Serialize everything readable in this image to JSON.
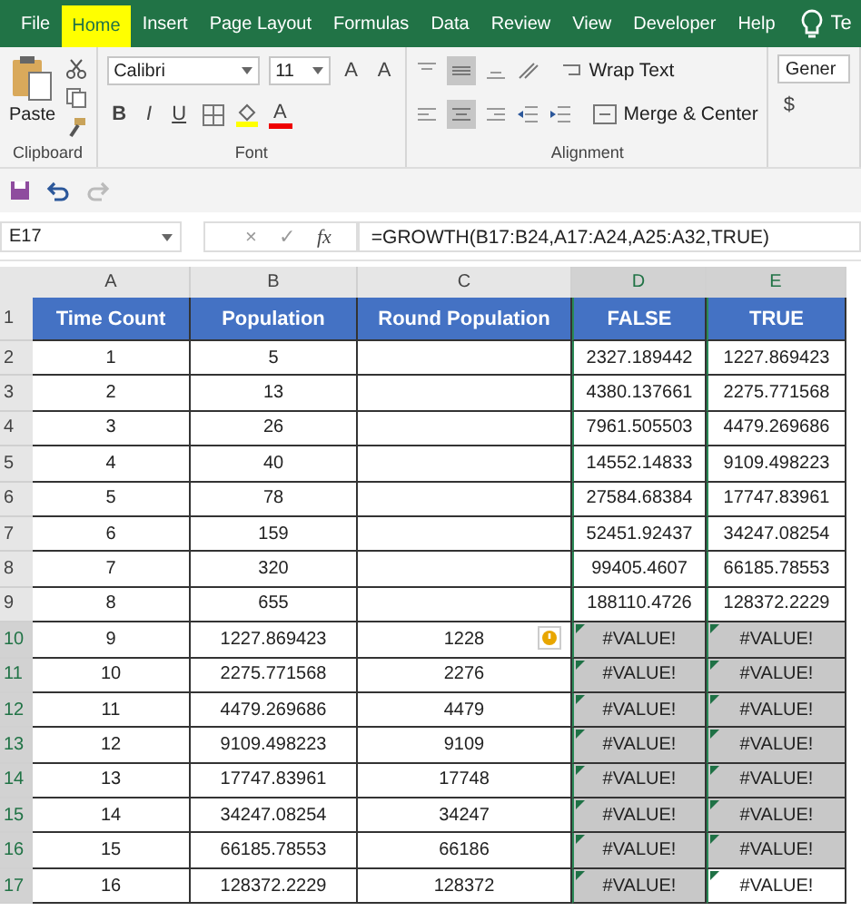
{
  "ribbon": {
    "tabs": [
      {
        "label": "File",
        "selected": false
      },
      {
        "label": "Home",
        "selected": true
      },
      {
        "label": "Insert",
        "selected": false
      },
      {
        "label": "Page Layout",
        "selected": false
      },
      {
        "label": "Formulas",
        "selected": false
      },
      {
        "label": "Data",
        "selected": false
      },
      {
        "label": "Review",
        "selected": false
      },
      {
        "label": "View",
        "selected": false
      },
      {
        "label": "Developer",
        "selected": false
      },
      {
        "label": "Help",
        "selected": false
      }
    ],
    "tell_me": "Te",
    "clipboard": {
      "paste": "Paste",
      "label": "Clipboard"
    },
    "font": {
      "name": "Calibri",
      "size": "11",
      "grow": "A",
      "shrink": "A",
      "bold": "B",
      "italic": "I",
      "underline": "U",
      "color_glyph": "A",
      "label": "Font"
    },
    "alignment": {
      "wrap_text": "Wrap Text",
      "merge_center": "Merge & Center",
      "label": "Alignment"
    },
    "number": {
      "format": "Gener",
      "currency": "$"
    }
  },
  "formula_bar": {
    "name_box": "E17",
    "cancel": "×",
    "enter": "✓",
    "fx": "fx",
    "formula": "=GROWTH(B17:B24,A17:A24,A25:A32,TRUE)"
  },
  "sheet": {
    "columns": [
      {
        "label": "A",
        "selected": false
      },
      {
        "label": "B",
        "selected": false
      },
      {
        "label": "C",
        "selected": false
      },
      {
        "label": "D",
        "selected": true
      },
      {
        "label": "E",
        "selected": true
      }
    ],
    "rows": [
      {
        "number": "1",
        "kind": "header",
        "selected": false,
        "error_marks": false,
        "warning": false,
        "cells": [
          "Time Count",
          "Population",
          "Round Population",
          "FALSE",
          "TRUE"
        ],
        "selected_cells": [
          false,
          false,
          false,
          false,
          false
        ]
      },
      {
        "number": "2",
        "kind": "data",
        "selected": false,
        "error_marks": false,
        "warning": false,
        "cells": [
          "1",
          "5",
          "",
          "2327.189442",
          "1227.869423"
        ],
        "selected_cells": [
          false,
          false,
          false,
          false,
          false
        ]
      },
      {
        "number": "3",
        "kind": "data",
        "selected": false,
        "error_marks": false,
        "warning": false,
        "cells": [
          "2",
          "13",
          "",
          "4380.137661",
          "2275.771568"
        ],
        "selected_cells": [
          false,
          false,
          false,
          false,
          false
        ]
      },
      {
        "number": "4",
        "kind": "data",
        "selected": false,
        "error_marks": false,
        "warning": false,
        "cells": [
          "3",
          "26",
          "",
          "7961.505503",
          "4479.269686"
        ],
        "selected_cells": [
          false,
          false,
          false,
          false,
          false
        ]
      },
      {
        "number": "5",
        "kind": "data",
        "selected": false,
        "error_marks": false,
        "warning": false,
        "cells": [
          "4",
          "40",
          "",
          "14552.14833",
          "9109.498223"
        ],
        "selected_cells": [
          false,
          false,
          false,
          false,
          false
        ]
      },
      {
        "number": "6",
        "kind": "data",
        "selected": false,
        "error_marks": false,
        "warning": false,
        "cells": [
          "5",
          "78",
          "",
          "27584.68384",
          "17747.83961"
        ],
        "selected_cells": [
          false,
          false,
          false,
          false,
          false
        ]
      },
      {
        "number": "7",
        "kind": "data",
        "selected": false,
        "error_marks": false,
        "warning": false,
        "cells": [
          "6",
          "159",
          "",
          "52451.92437",
          "34247.08254"
        ],
        "selected_cells": [
          false,
          false,
          false,
          false,
          false
        ]
      },
      {
        "number": "8",
        "kind": "data",
        "selected": false,
        "error_marks": false,
        "warning": false,
        "cells": [
          "7",
          "320",
          "",
          "99405.4607",
          "66185.78553"
        ],
        "selected_cells": [
          false,
          false,
          false,
          false,
          false
        ]
      },
      {
        "number": "9",
        "kind": "data",
        "selected": false,
        "error_marks": false,
        "warning": false,
        "cells": [
          "8",
          "655",
          "",
          "188110.4726",
          "128372.2229"
        ],
        "selected_cells": [
          false,
          false,
          false,
          false,
          false
        ]
      },
      {
        "number": "10",
        "kind": "data",
        "selected": true,
        "error_marks": true,
        "warning": true,
        "cells": [
          "9",
          "1227.869423",
          "1228",
          "#VALUE!",
          "#VALUE!"
        ],
        "selected_cells": [
          false,
          false,
          false,
          true,
          true
        ]
      },
      {
        "number": "11",
        "kind": "data",
        "selected": true,
        "error_marks": true,
        "warning": false,
        "cells": [
          "10",
          "2275.771568",
          "2276",
          "#VALUE!",
          "#VALUE!"
        ],
        "selected_cells": [
          false,
          false,
          false,
          true,
          true
        ]
      },
      {
        "number": "12",
        "kind": "data",
        "selected": true,
        "error_marks": true,
        "warning": false,
        "cells": [
          "11",
          "4479.269686",
          "4479",
          "#VALUE!",
          "#VALUE!"
        ],
        "selected_cells": [
          false,
          false,
          false,
          true,
          true
        ]
      },
      {
        "number": "13",
        "kind": "data",
        "selected": true,
        "error_marks": true,
        "warning": false,
        "cells": [
          "12",
          "9109.498223",
          "9109",
          "#VALUE!",
          "#VALUE!"
        ],
        "selected_cells": [
          false,
          false,
          false,
          true,
          true
        ]
      },
      {
        "number": "14",
        "kind": "data",
        "selected": true,
        "error_marks": true,
        "warning": false,
        "cells": [
          "13",
          "17747.83961",
          "17748",
          "#VALUE!",
          "#VALUE!"
        ],
        "selected_cells": [
          false,
          false,
          false,
          true,
          true
        ]
      },
      {
        "number": "15",
        "kind": "data",
        "selected": true,
        "error_marks": true,
        "warning": false,
        "cells": [
          "14",
          "34247.08254",
          "34247",
          "#VALUE!",
          "#VALUE!"
        ],
        "selected_cells": [
          false,
          false,
          false,
          true,
          true
        ]
      },
      {
        "number": "16",
        "kind": "data",
        "selected": true,
        "error_marks": true,
        "warning": false,
        "cells": [
          "15",
          "66185.78553",
          "66186",
          "#VALUE!",
          "#VALUE!"
        ],
        "selected_cells": [
          false,
          false,
          false,
          true,
          true
        ]
      },
      {
        "number": "17",
        "kind": "data",
        "selected": true,
        "error_marks": true,
        "warning": false,
        "cells": [
          "16",
          "128372.2229",
          "128372",
          "#VALUE!",
          "#VALUE!"
        ],
        "selected_cells": [
          false,
          false,
          false,
          true,
          false
        ]
      }
    ]
  }
}
